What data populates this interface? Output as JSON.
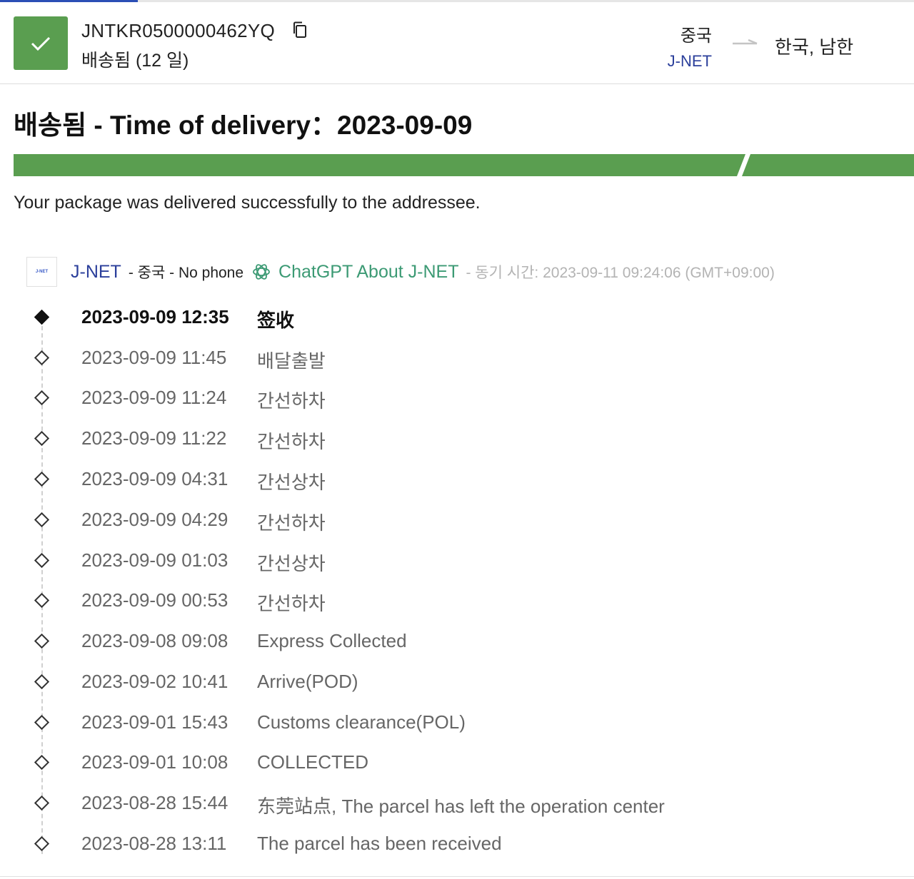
{
  "header": {
    "tracking_number": "JNTKR0500000462YQ",
    "status": "배송됨 (12 일)",
    "origin_country": "중국",
    "origin_carrier": "J-NET",
    "destination": "한국, 남한"
  },
  "title": "배송됨 - Time of delivery：2023-09-09",
  "progress": {
    "delivered_fraction": 1.0,
    "color": "#5a9e50"
  },
  "summary": "Your package was delivered successfully to the addressee.",
  "carrier": {
    "logo_text": "J-NET",
    "name": "J-NET",
    "meta": "- 중국 - No phone",
    "chatgpt_link": "ChatGPT About J-NET",
    "sync_time": "- 동기 시간: 2023-09-11 09:24:06 (GMT+09:00)"
  },
  "events": [
    {
      "time": "2023-09-09 12:35",
      "desc": "签收"
    },
    {
      "time": "2023-09-09 11:45",
      "desc": "배달출발"
    },
    {
      "time": "2023-09-09 11:24",
      "desc": "간선하차"
    },
    {
      "time": "2023-09-09 11:22",
      "desc": "간선하차"
    },
    {
      "time": "2023-09-09 04:31",
      "desc": "간선상차"
    },
    {
      "time": "2023-09-09 04:29",
      "desc": "간선하차"
    },
    {
      "time": "2023-09-09 01:03",
      "desc": "간선상차"
    },
    {
      "time": "2023-09-09 00:53",
      "desc": "간선하차"
    },
    {
      "time": "2023-09-08 09:08",
      "desc": "Express Collected"
    },
    {
      "time": "2023-09-02 10:41",
      "desc": "Arrive(POD)"
    },
    {
      "time": "2023-09-01 15:43",
      "desc": "Customs clearance(POL)"
    },
    {
      "time": "2023-09-01 10:08",
      "desc": "COLLECTED"
    },
    {
      "time": "2023-08-28 15:44",
      "desc": "东莞站点, The parcel has left the operation center"
    },
    {
      "time": "2023-08-28 13:11",
      "desc": "The parcel has been received"
    }
  ],
  "icons": {
    "status": "check-icon",
    "copy": "copy-icon",
    "route": "arrow-right-icon",
    "chatgpt": "chatgpt-icon"
  }
}
